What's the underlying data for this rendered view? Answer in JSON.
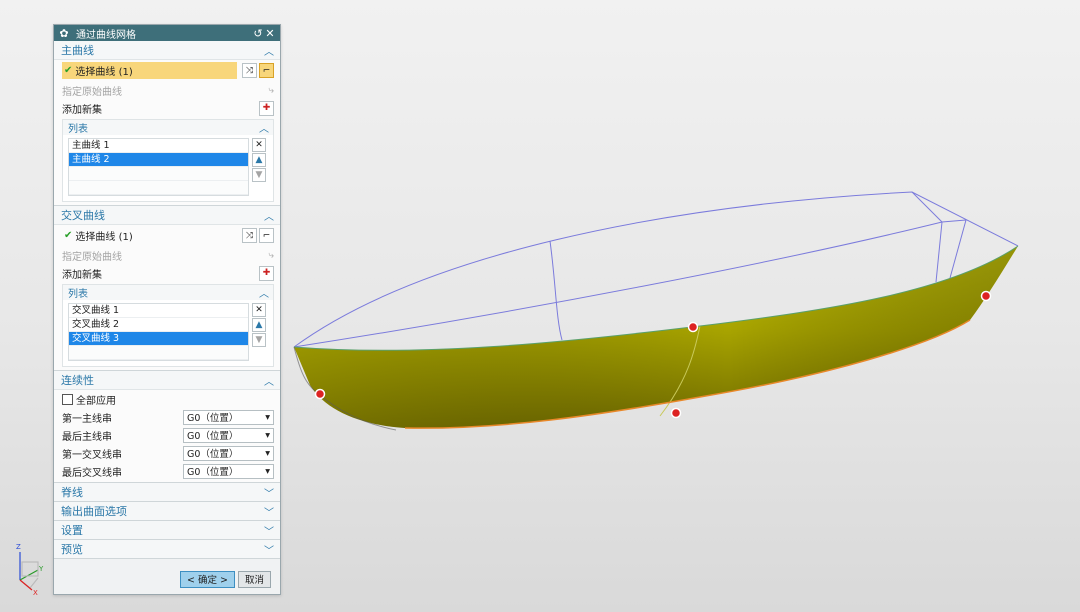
{
  "dialog": {
    "title": "通过曲线网格",
    "title_icons": [
      "gear-icon",
      "reset-icon",
      "close-icon"
    ],
    "primary": {
      "header": "主曲线",
      "select_label": "选择曲线 (1)",
      "specify_label": "指定原始曲线",
      "add_set_label": "添加新集",
      "list_header": "列表",
      "items": [
        "主曲线 1",
        "主曲线 2"
      ],
      "selected_index": 1
    },
    "cross": {
      "header": "交叉曲线",
      "select_label": "选择曲线 (1)",
      "specify_label": "指定原始曲线",
      "add_set_label": "添加新集",
      "list_header": "列表",
      "items": [
        "交叉曲线 1",
        "交叉曲线 2",
        "交叉曲线 3"
      ],
      "selected_index": 2
    },
    "continuity": {
      "header": "连续性",
      "apply_all_label": "全部应用",
      "rows": [
        {
          "label": "第一主线串",
          "value": "G0（位置）"
        },
        {
          "label": "最后主线串",
          "value": "G0（位置）"
        },
        {
          "label": "第一交叉线串",
          "value": "G0（位置）"
        },
        {
          "label": "最后交叉线串",
          "value": "G0（位置）"
        }
      ]
    },
    "collapsed_sections": [
      "脊线",
      "输出曲面选项",
      "设置",
      "预览"
    ],
    "ok_label": "< 确定 >",
    "cancel_label": "取消"
  },
  "triad": {
    "z": "Z",
    "y": "Y",
    "x": "X"
  },
  "colors": {
    "title_bar": "#3e6f7a",
    "section_header": "#2b78a8",
    "selected_row": "#1f87e8",
    "active_select": "#f8d67b",
    "surface": "#a8a800",
    "wire": "#7b7bdc",
    "edge": "#e8882a"
  }
}
